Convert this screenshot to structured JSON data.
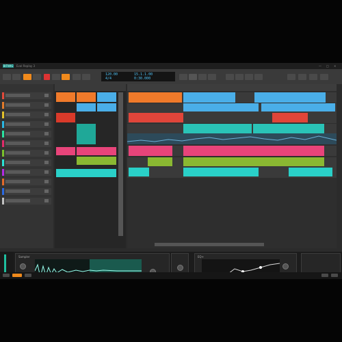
{
  "app": {
    "badge": "BITWIG",
    "project_title": "Eval Replay 3"
  },
  "window_controls": [
    "—",
    "□",
    "✕"
  ],
  "toolbar": {
    "buttons": [
      "menu",
      "play",
      "stop",
      "record",
      "loop",
      "punch",
      "metronome",
      "overdub"
    ],
    "counter": {
      "tempo": "120.00",
      "signature": "4/4",
      "position": "15.1.1.00",
      "time": "0:30.000"
    }
  },
  "mixer": {
    "tracks": [
      {
        "color": "#e34a3a"
      },
      {
        "color": "#e37b2a"
      },
      {
        "color": "#e3c12a"
      },
      {
        "color": "#2ab7e3"
      },
      {
        "color": "#2ae3a0"
      },
      {
        "color": "#e32a6a"
      },
      {
        "color": "#7ac12a"
      },
      {
        "color": "#2ae3d5"
      },
      {
        "color": "#b32ae3"
      },
      {
        "color": "#e36a2a"
      },
      {
        "color": "#2a6ae3"
      },
      {
        "color": "#c1c1c1"
      }
    ]
  },
  "clip_launcher": {
    "scenes": [
      "Scene 1",
      "Scene 2",
      "Scene 3"
    ]
  },
  "arranger": {
    "lanes": [
      {
        "clips": [
          {
            "color": "#f07a2a"
          },
          {
            "color": "#4aaee8"
          },
          {
            "color": "#4aaee8"
          }
        ]
      },
      {
        "clips": [
          {
            "color": "#4aaee8"
          },
          {
            "color": "#4aaee8"
          }
        ]
      },
      {
        "clips": [
          {
            "color": "#e0453a"
          },
          {
            "color": "#e0453a"
          }
        ]
      },
      {
        "clips": [
          {
            "color": "#2ac3b7"
          },
          {
            "color": "#2ac3b7"
          }
        ]
      },
      {
        "clips": [
          {
            "color": "#6ab0d8"
          }
        ]
      },
      {
        "clips": [
          {
            "color": "#e8447a"
          },
          {
            "color": "#e8447a"
          }
        ]
      },
      {
        "clips": [
          {
            "color": "#8ab832"
          },
          {
            "color": "#8ab832"
          }
        ]
      },
      {
        "clips": [
          {
            "color": "#2ad0c8"
          },
          {
            "color": "#2ad0c8"
          }
        ]
      }
    ]
  },
  "devices": {
    "sampler_label": "Sampler",
    "eq_label": "EQ+"
  },
  "accent": "#1fbf9f"
}
